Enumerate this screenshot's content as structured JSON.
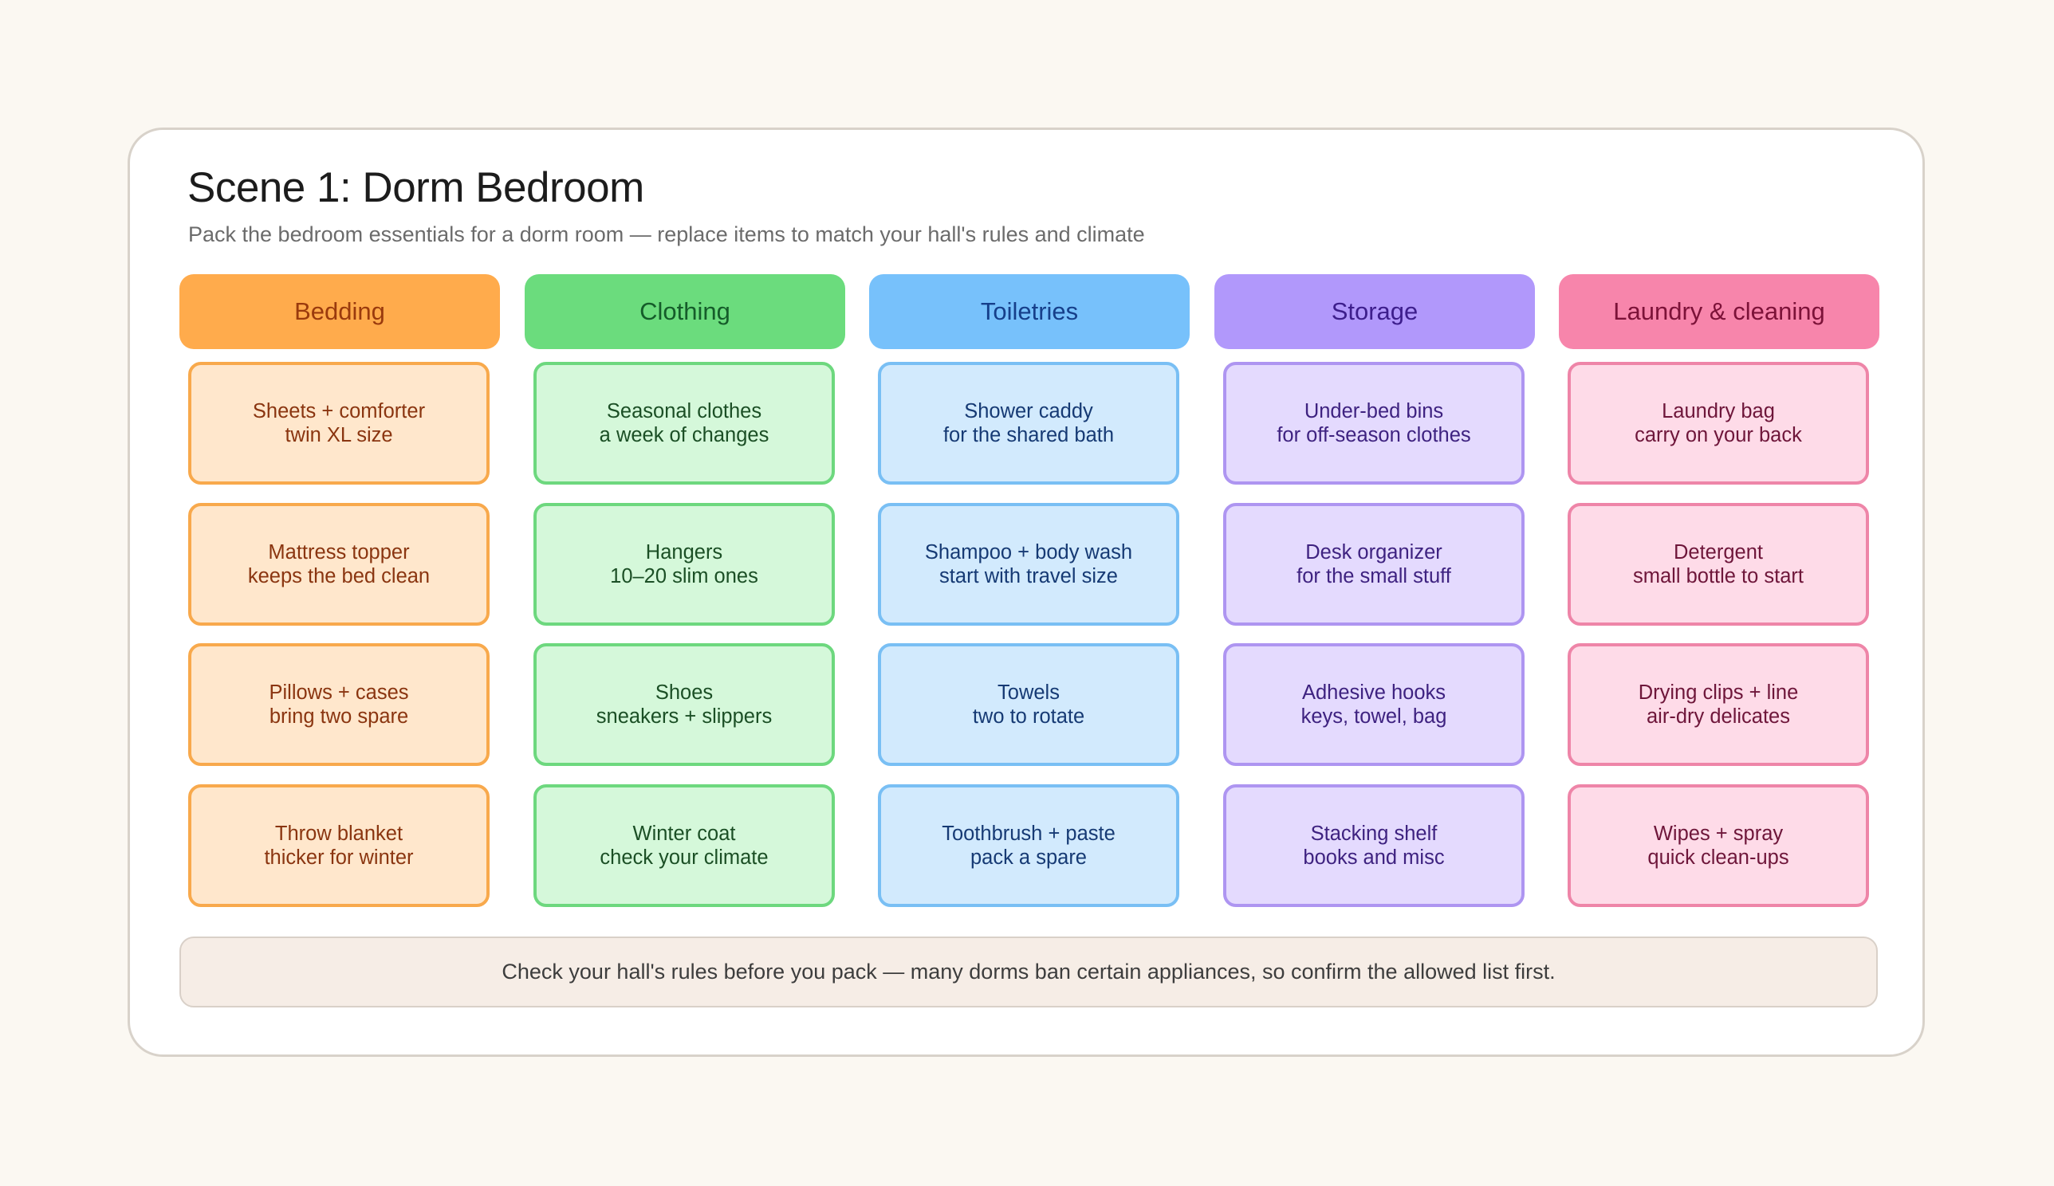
{
  "scene": {
    "title": "Scene 1: Dorm Bedroom",
    "subtitle": "Pack the bedroom essentials for a dorm room — replace items to match your hall's rules and climate"
  },
  "columns": [
    {
      "label": "Bedding",
      "colors": {
        "header_bg": "#ffab4c",
        "header_text": "#9a3a0d",
        "item_bg": "#ffe7cc",
        "item_border": "#f8a94c",
        "item_text": "#8a3510"
      },
      "items": [
        {
          "name": "Sheets + comforter",
          "note": "twin XL size"
        },
        {
          "name": "Mattress topper",
          "note": "keeps the bed clean"
        },
        {
          "name": "Pillows + cases",
          "note": "bring two spare"
        },
        {
          "name": "Throw blanket",
          "note": "thicker for winter"
        }
      ]
    },
    {
      "label": "Clothing",
      "colors": {
        "header_bg": "#6bdc7d",
        "header_text": "#155c2a",
        "item_bg": "#d5f8da",
        "item_border": "#6dd87e",
        "item_text": "#1b4f25"
      },
      "items": [
        {
          "name": "Seasonal clothes",
          "note": "a week of changes"
        },
        {
          "name": "Hangers",
          "note": "10–20 slim ones"
        },
        {
          "name": "Shoes",
          "note": "sneakers + slippers"
        },
        {
          "name": "Winter coat",
          "note": "check your climate"
        }
      ]
    },
    {
      "label": "Toiletries",
      "colors": {
        "header_bg": "#77c1fb",
        "header_text": "#163f8a",
        "item_bg": "#d2eafd",
        "item_border": "#79bff4",
        "item_text": "#163a74"
      },
      "items": [
        {
          "name": "Shower caddy",
          "note": "for the shared bath"
        },
        {
          "name": "Shampoo + body wash",
          "note": "start with travel size"
        },
        {
          "name": "Towels",
          "note": "two to rotate"
        },
        {
          "name": "Toothbrush + paste",
          "note": "pack a spare"
        }
      ]
    },
    {
      "label": "Storage",
      "colors": {
        "header_bg": "#b198fb",
        "header_text": "#3d1e8c",
        "item_bg": "#e4dafe",
        "item_border": "#ae95f1",
        "item_text": "#3e2280"
      },
      "items": [
        {
          "name": "Under-bed bins",
          "note": "for off-season clothes"
        },
        {
          "name": "Desk organizer",
          "note": "for the small stuff"
        },
        {
          "name": "Adhesive hooks",
          "note": "keys, towel, bag"
        },
        {
          "name": "Stacking shelf",
          "note": "books and misc"
        }
      ]
    },
    {
      "label": "Laundry & cleaning",
      "colors": {
        "header_bg": "#f785ab",
        "header_text": "#7c1238",
        "item_bg": "#fedbe8",
        "item_border": "#ee85a8",
        "item_text": "#6e163a"
      },
      "items": [
        {
          "name": "Laundry bag",
          "note": "carry on your back"
        },
        {
          "name": "Detergent",
          "note": "small bottle to start"
        },
        {
          "name": "Drying clips + line",
          "note": "air-dry delicates"
        },
        {
          "name": "Wipes + spray",
          "note": "quick clean-ups"
        }
      ]
    }
  ],
  "footer": {
    "note": "Check your hall's rules before you pack — many dorms ban certain appliances, so confirm the allowed list first."
  }
}
